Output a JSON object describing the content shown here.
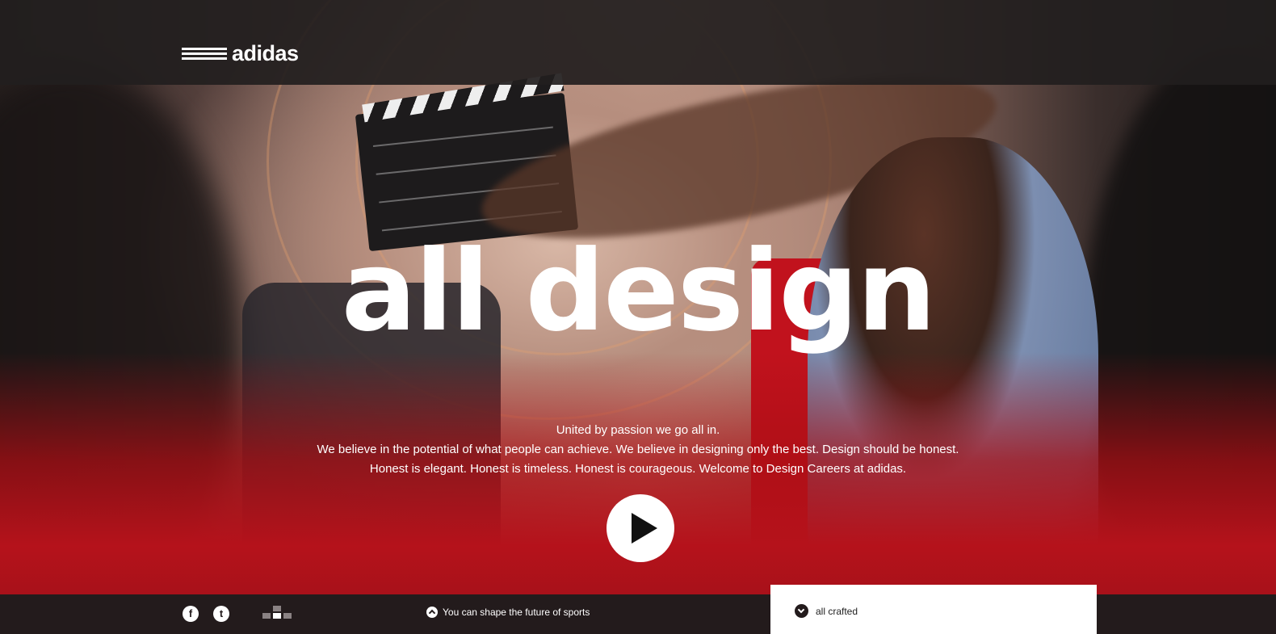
{
  "brand": {
    "logo_text": "adidas",
    "logo_icon": "adidas-three-stripes-logo"
  },
  "hero": {
    "headline": "all design",
    "copy_lines": [
      "United by passion we go all in.",
      "We believe in the potential of what people can achieve. We believe in designing only the best. Design should be honest.",
      "Honest is elegant. Honest is timeless. Honest is courageous. Welcome to Design Careers at adidas."
    ],
    "play_icon": "play-icon"
  },
  "footer": {
    "social": [
      {
        "glyph": "f",
        "icon": "facebook-icon"
      },
      {
        "glyph": "t",
        "icon": "twitter-icon"
      }
    ],
    "grid_icon": "grid-menu-icon",
    "tagline": "You can shape the future of sports",
    "panel_label": "all crafted"
  },
  "colors": {
    "accent_red": "#b5121b",
    "bar_dark": "#231b1c"
  }
}
